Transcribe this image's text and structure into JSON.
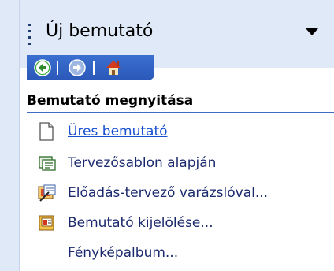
{
  "pane": {
    "title": "Új bemutató"
  },
  "nav": {
    "back_icon": "back-arrow-icon",
    "forward_icon": "forward-arrow-icon",
    "home_icon": "home-icon"
  },
  "section": {
    "heading": "Bemutató megnyitása",
    "items": [
      {
        "label": "Üres bemutató",
        "icon": "blank-document-icon"
      },
      {
        "label": "Tervezősablon alapján",
        "icon": "design-template-icon"
      },
      {
        "label": "Előadás-tervező varázslóval...",
        "icon": "wizard-icon"
      },
      {
        "label": "Bemutató kijelölése...",
        "icon": "open-presentation-icon"
      },
      {
        "label": "Fényképalbum...",
        "icon": ""
      }
    ]
  },
  "colors": {
    "pane_header": "#dfe9f7",
    "nav_bar": "#2f62c4",
    "link": "#1650d0",
    "heading_rule": "#3d6cc0"
  }
}
